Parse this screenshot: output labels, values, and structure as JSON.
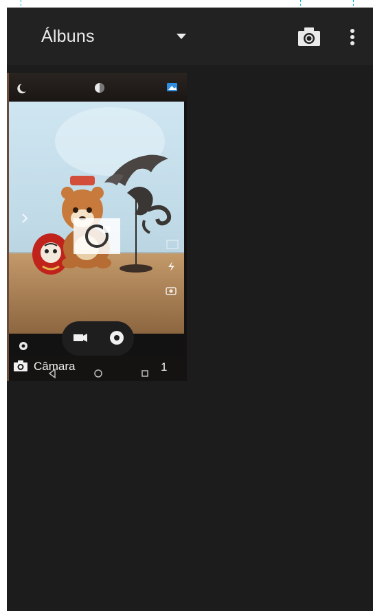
{
  "appbar": {
    "title": "Álbuns",
    "dropdown_icon": "triangle-down-icon",
    "camera_icon": "camera-icon",
    "more_icon": "more-vertical-icon"
  },
  "albums": [
    {
      "name": "Câmara",
      "count": "1",
      "icon": "camera-icon"
    }
  ],
  "colors": {
    "background": "#1c1c1c",
    "appbar": "#222222",
    "text": "#ebebeb",
    "accent_blue": "#2f8ee0"
  }
}
